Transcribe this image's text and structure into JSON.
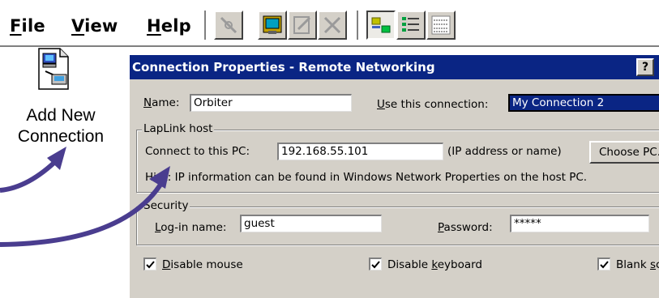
{
  "menu": {
    "file": {
      "accel": "F",
      "rest": "ile"
    },
    "view": {
      "accel": "V",
      "rest": "iew"
    },
    "help": {
      "accel": "H",
      "rest": "elp"
    }
  },
  "toolbar": {
    "icons": [
      "connect-icon",
      "properties-icon",
      "edit-icon",
      "delete-icon",
      "large-icons-icon",
      "list-icon",
      "details-icon"
    ]
  },
  "desktop": {
    "icon_label_line1": "Add New",
    "icon_label_line2": "Connection"
  },
  "dialog": {
    "title": "Connection Properties - Remote Networking",
    "help_label": "?",
    "name": {
      "accel": "N",
      "rest": "ame:",
      "value": "Orbiter"
    },
    "use_connection": {
      "accel": "U",
      "rest": "se this connection:",
      "value": "My Connection 2"
    },
    "lanlink": {
      "title": "LapLink host",
      "connect_label": "Connect to this PC:",
      "connect_value": "192.168.55.101",
      "connect_hint": "(IP address or name)",
      "choose_pc_label": "Choose PC...",
      "hint": "Hint: IP information can be found in Windows Network Properties on the host PC."
    },
    "security": {
      "title": "Security",
      "login": {
        "accel": "L",
        "rest": "og-in name:",
        "value": "guest"
      },
      "password": {
        "accel": "P",
        "rest": "assword:",
        "value": "*****"
      }
    },
    "options": {
      "disable_mouse": {
        "accel": "D",
        "rest": "isable mouse",
        "checked": true
      },
      "disable_keyboard": {
        "pre": "Disable ",
        "accel": "k",
        "rest": "eyboard",
        "checked": true
      },
      "blank_screen": {
        "pre": "Blank ",
        "accel": "s",
        "rest": "creen",
        "checked": true
      }
    }
  },
  "colors": {
    "title_bar": "#0a2584",
    "dialog_face": "#d4d0c8",
    "arrow": "#4a3d8f"
  }
}
